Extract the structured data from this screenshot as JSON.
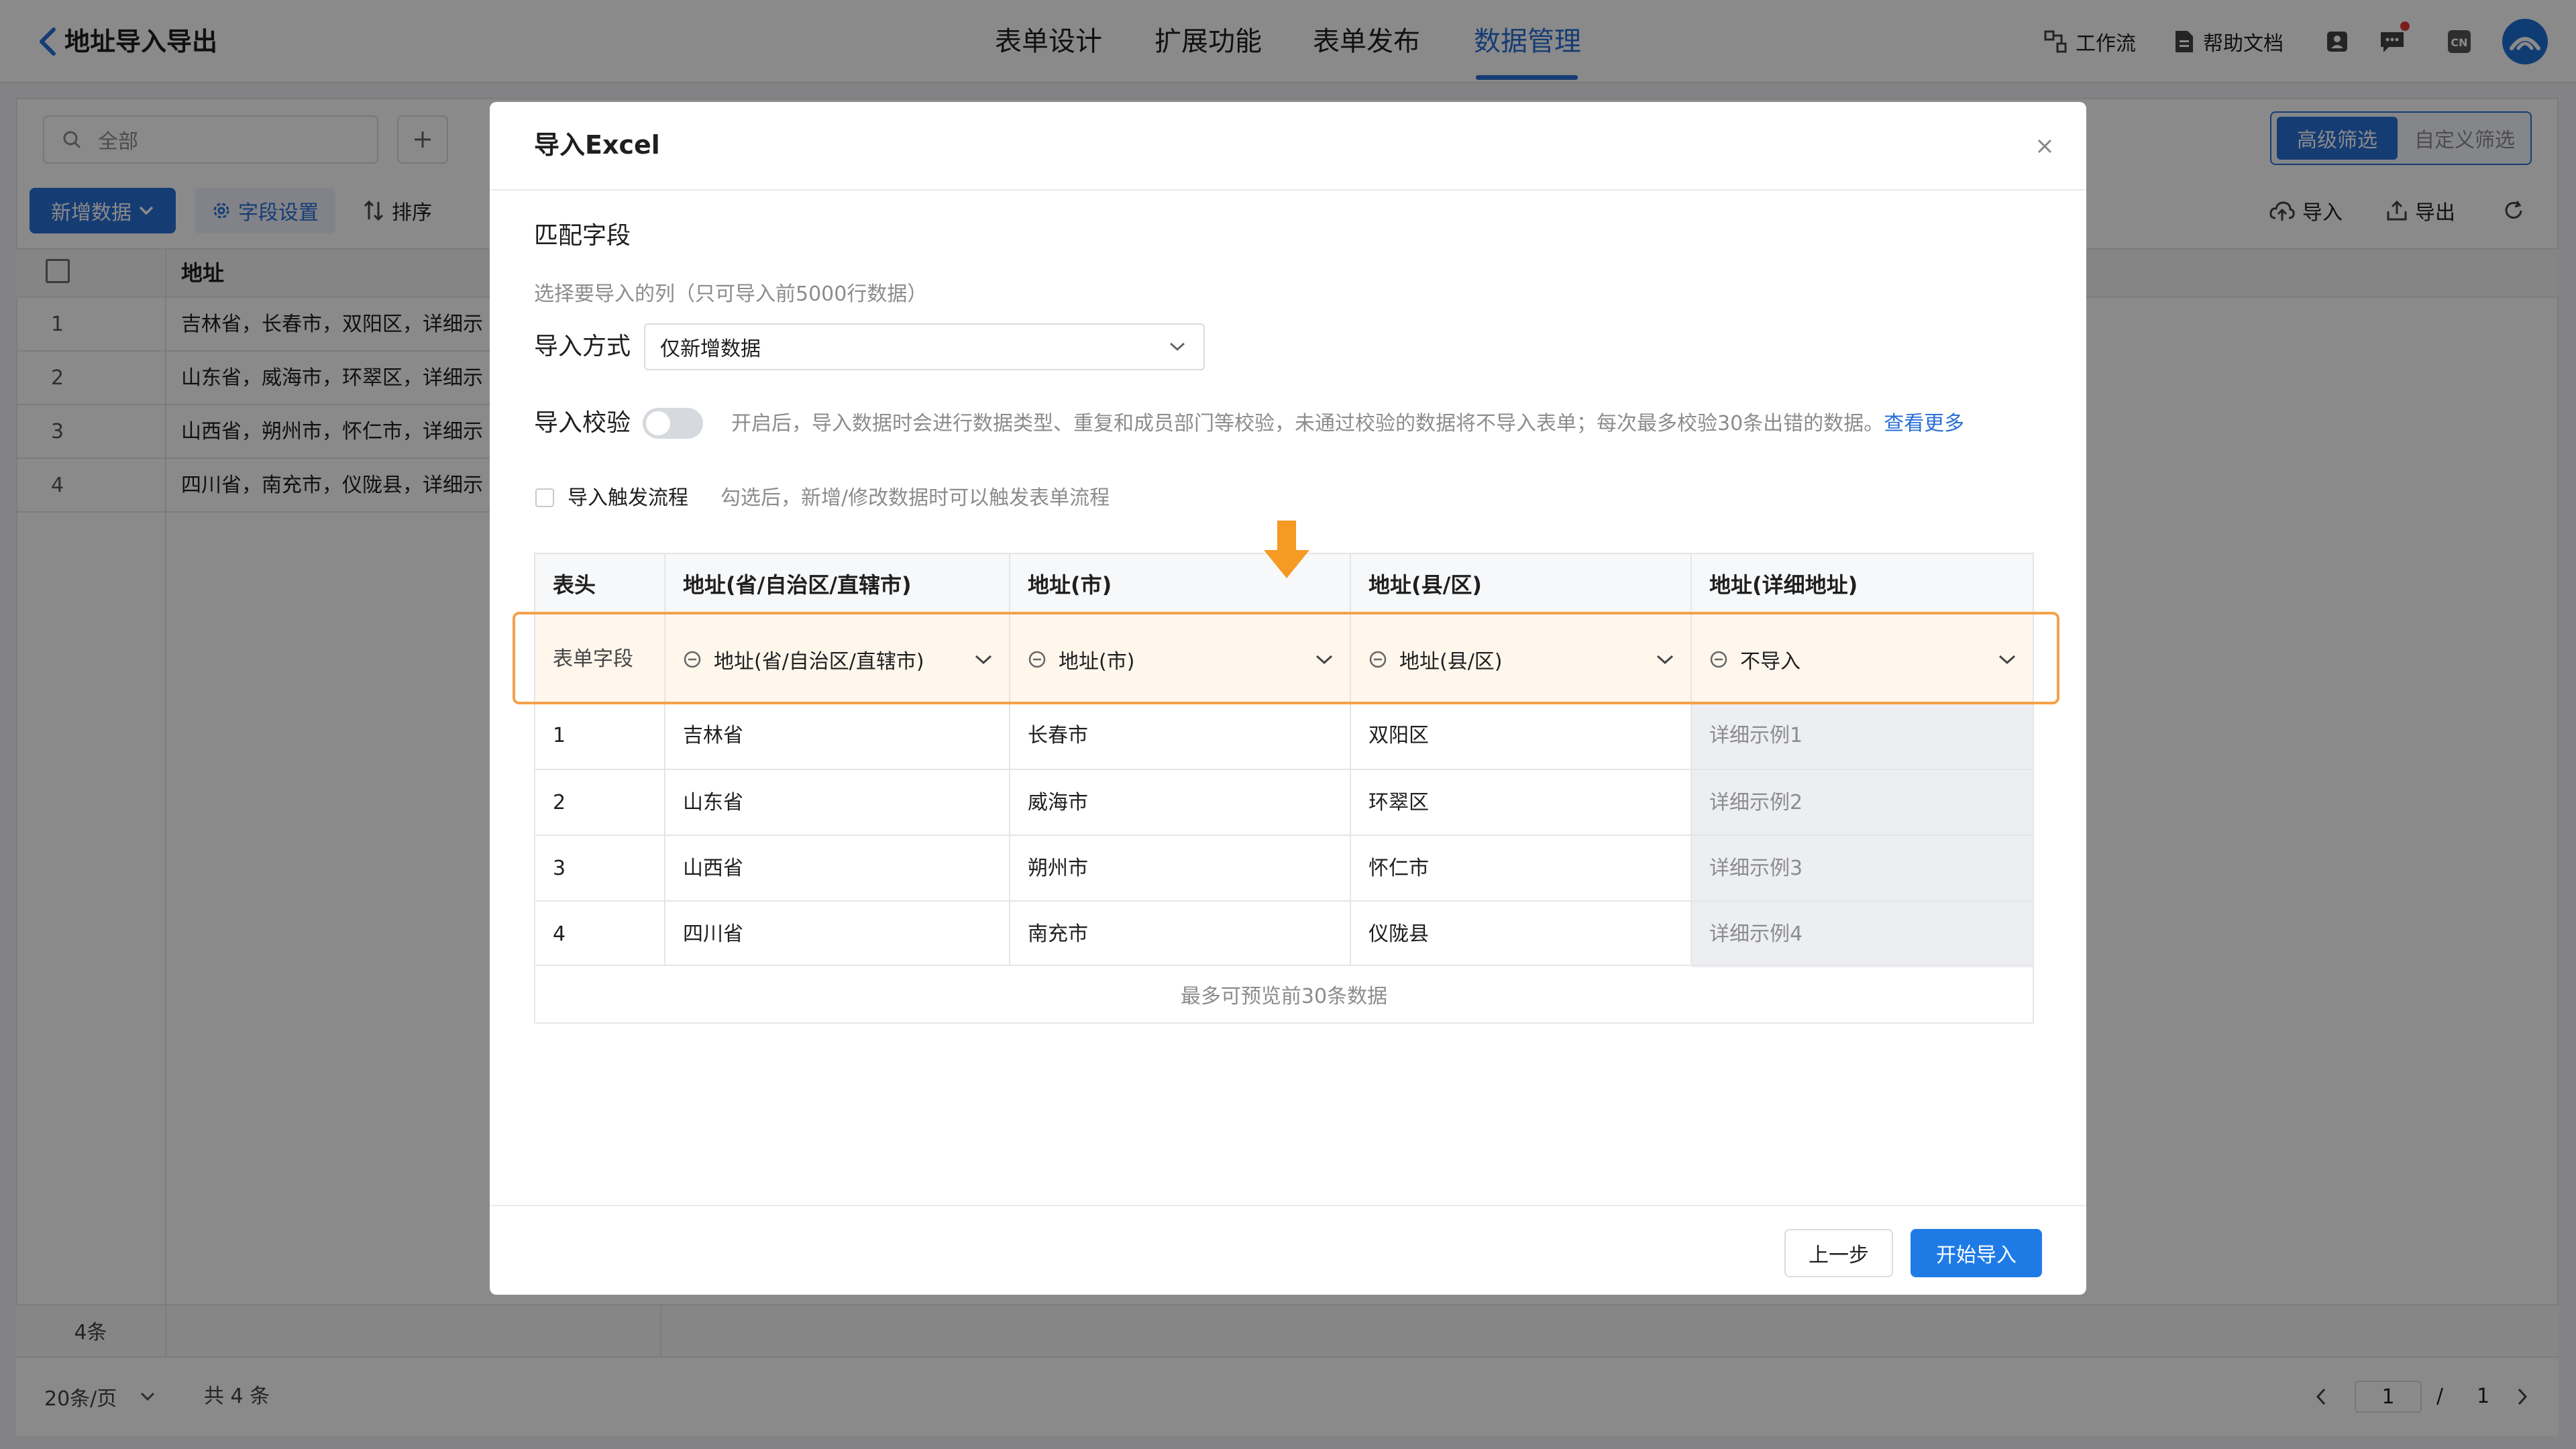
{
  "header": {
    "title": "地址导入导出",
    "nav_tabs": [
      "表单设计",
      "扩展功能",
      "表单发布",
      "数据管理"
    ],
    "active_tab": "数据管理",
    "workflow": "工作流",
    "help_docs": "帮助文档",
    "language_badge": "CN"
  },
  "background": {
    "search_placeholder": "全部",
    "filter_advanced": "高级筛选",
    "filter_custom": "自定义筛选",
    "new_data": "新增数据",
    "field_settings": "字段设置",
    "sort": "排序",
    "import": "导入",
    "export": "导出",
    "column_header": "地址",
    "rows": [
      {
        "no": "1",
        "address": "吉林省，长春市，双阳区，详细示"
      },
      {
        "no": "2",
        "address": "山东省，威海市，环翠区，详细示"
      },
      {
        "no": "3",
        "address": "山西省，朔州市，怀仁市，详细示"
      },
      {
        "no": "4",
        "address": "四川省，南充市，仪陇县，详细示"
      }
    ],
    "record_count": "4条",
    "page_size": "20条/页",
    "total": "共 4 条",
    "current_page": "1",
    "page_separator": "/",
    "total_pages": "1"
  },
  "modal": {
    "title": "导入Excel",
    "section_title": "匹配字段",
    "hint": "选择要导入的列（只可导入前5000行数据）",
    "import_mode_label": "导入方式",
    "import_mode_value": "仅新增数据",
    "verify_label": "导入校验",
    "verify_enabled": false,
    "verify_desc": "开启后，导入数据时会进行数据类型、重复和成员部门等校验，未通过校验的数据将不导入表单；每次最多校验30条出错的数据。",
    "verify_more": "查看更多",
    "trigger_label": "导入触发流程",
    "trigger_checked": false,
    "trigger_desc": "勾选后，新增/修改数据时可以触发表单流程",
    "table": {
      "headers": [
        "表头",
        "地址(省/自治区/直辖市)",
        "地址(市)",
        "地址(县/区)",
        "地址(详细地址)"
      ],
      "mapping_label": "表单字段",
      "mapping": [
        "地址(省/自治区/直辖市)",
        "地址(市)",
        "地址(县/区)",
        "不导入"
      ],
      "rows": [
        [
          "1",
          "吉林省",
          "长春市",
          "双阳区",
          "详细示例1"
        ],
        [
          "2",
          "山东省",
          "威海市",
          "环翠区",
          "详细示例2"
        ],
        [
          "3",
          "山西省",
          "朔州市",
          "怀仁市",
          "详细示例3"
        ],
        [
          "4",
          "四川省",
          "南充市",
          "仪陇县",
          "详细示例4"
        ]
      ],
      "preview_note": "最多可预览前30条数据"
    },
    "btn_prev": "上一步",
    "btn_start": "开始导入"
  },
  "colors": {
    "primary": "#2a6fd6",
    "highlight_border": "#f5a04a",
    "highlight_fill": "#fff6ec",
    "arrow": "#f59a23"
  }
}
